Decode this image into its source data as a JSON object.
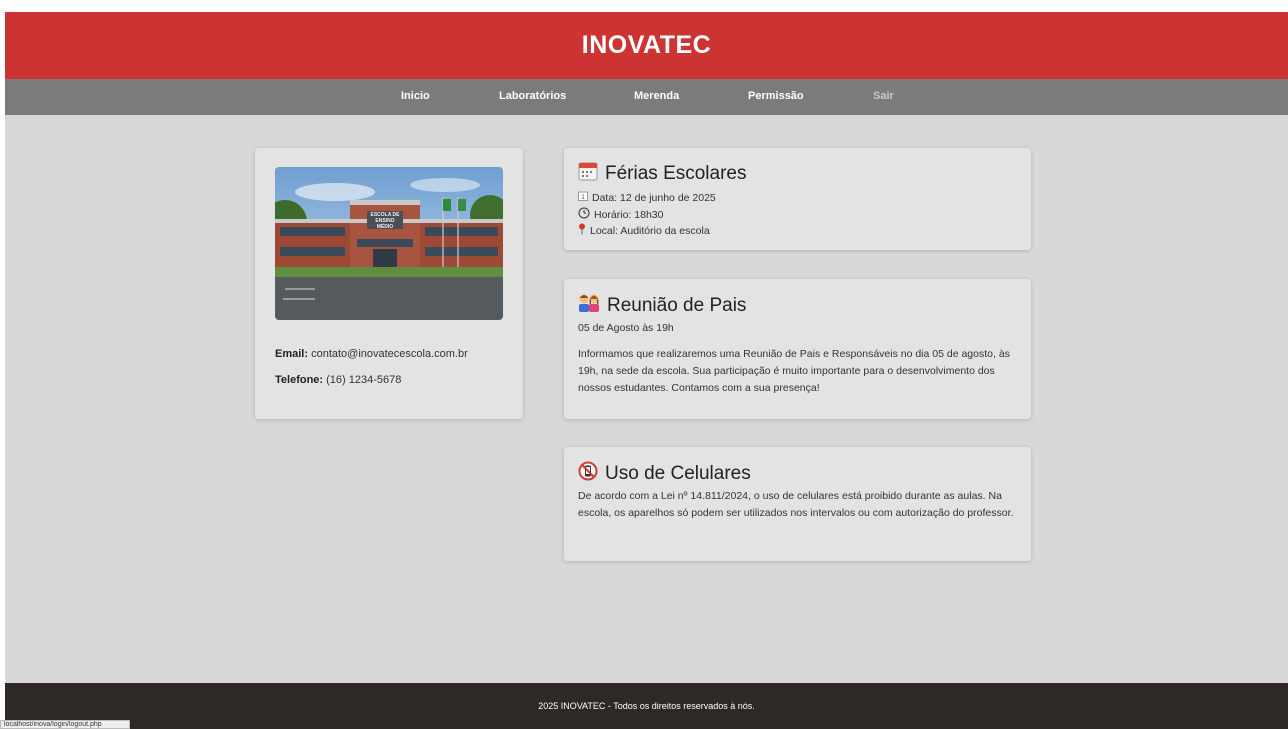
{
  "header": {
    "title": "INOVATEC"
  },
  "nav": {
    "items": [
      {
        "label": "Inicio"
      },
      {
        "label": "Laboratórios"
      },
      {
        "label": "Merenda"
      },
      {
        "label": "Permissão"
      },
      {
        "label": "Sair"
      }
    ]
  },
  "school": {
    "image_sign_lines": [
      "ESCOLA DE",
      "ENSINO MÉDIO"
    ],
    "email_label": "Email:",
    "email": "contato@inovatecescola.com.br",
    "phone_label": "Telefone:",
    "phone": "(16) 1234-5678"
  },
  "events": [
    {
      "title": "Férias Escolares",
      "icon": "calendar-icon",
      "lines": [
        {
          "icon": "date-icon",
          "text": "Data: 12 de junho de 2025"
        },
        {
          "icon": "clock-icon",
          "text": "Horário: 18h30"
        },
        {
          "icon": "pin-icon",
          "text": "Local: Auditório da escola"
        }
      ]
    },
    {
      "title": "Reunião de Pais",
      "icon": "family-icon",
      "subtitle": "05 de Agosto às 19h",
      "body": "Informamos que realizaremos uma Reunião de Pais e Responsáveis no dia 05 de agosto, às 19h, na sede da escola. Sua participação é muito importante para o desenvolvimento dos nossos estudantes. Contamos com a sua presença!"
    },
    {
      "title": "Uso de Celulares",
      "icon": "no-phone-icon",
      "body": "De acordo com a Lei nº 14.811/2024, o uso de celulares está proibido durante as aulas. Na escola, os aparelhos só podem ser utilizados nos intervalos ou com autorização do professor."
    }
  ],
  "footer": {
    "text": "2025 INOVATEC - Todos os direitos reservados à nós."
  },
  "status_bar": {
    "url": "localhost/inova/login/logout.php"
  },
  "colors": {
    "header": "#cc3333",
    "nav": "#7b7b7b",
    "page": "#d8d8d8",
    "card": "#e3e3e3",
    "footer": "#2e2827"
  }
}
